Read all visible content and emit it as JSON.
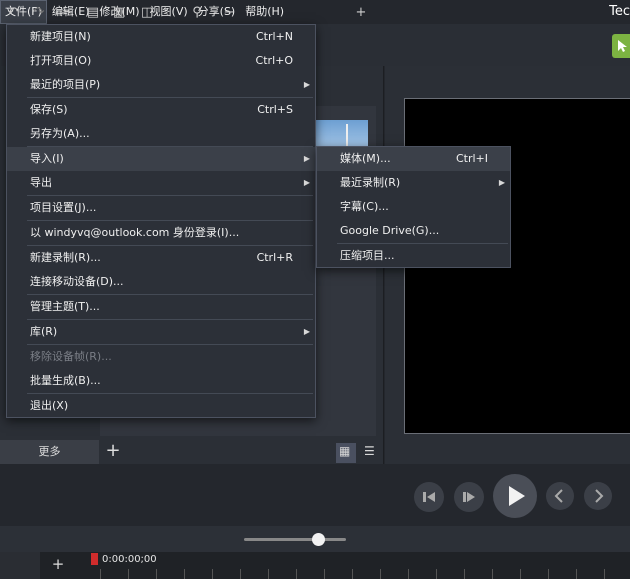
{
  "menubar": {
    "items": [
      {
        "label": "文件(F)"
      },
      {
        "label": "编辑(E)"
      },
      {
        "label": "修改(M)"
      },
      {
        "label": "视图(V)"
      },
      {
        "label": "分享(S)"
      },
      {
        "label": "帮助(H)"
      }
    ],
    "brand": "Tec"
  },
  "file_menu": {
    "items": [
      {
        "label": "新建项目(N)",
        "shortcut": "Ctrl+N"
      },
      {
        "label": "打开项目(O)",
        "shortcut": "Ctrl+O"
      },
      {
        "label": "最近的项目(P)"
      },
      {
        "label": "保存(S)",
        "shortcut": "Ctrl+S"
      },
      {
        "label": "另存为(A)..."
      },
      {
        "label": "导入(I)"
      },
      {
        "label": "导出"
      },
      {
        "label": "项目设置(J)..."
      },
      {
        "label": "以 windyvq@outlook.com 身份登录(I)..."
      },
      {
        "label": "新建录制(R)...",
        "shortcut": "Ctrl+R"
      },
      {
        "label": "连接移动设备(D)..."
      },
      {
        "label": "管理主题(T)..."
      },
      {
        "label": "库(R)"
      },
      {
        "label": "移除设备帧(R)..."
      },
      {
        "label": "批量生成(B)..."
      },
      {
        "label": "退出(X)"
      }
    ]
  },
  "import_menu": {
    "items": [
      {
        "label": "媒体(M)...",
        "shortcut": "Ctrl+I"
      },
      {
        "label": "最近录制(R)"
      },
      {
        "label": "字幕(C)..."
      },
      {
        "label": "Google Drive(G)..."
      },
      {
        "label": "压缩项目..."
      }
    ]
  },
  "library": {
    "more_label": "更多",
    "add_label": "+"
  },
  "timeline": {
    "timecode": "0:00:00;00",
    "add_track_label": "+"
  }
}
